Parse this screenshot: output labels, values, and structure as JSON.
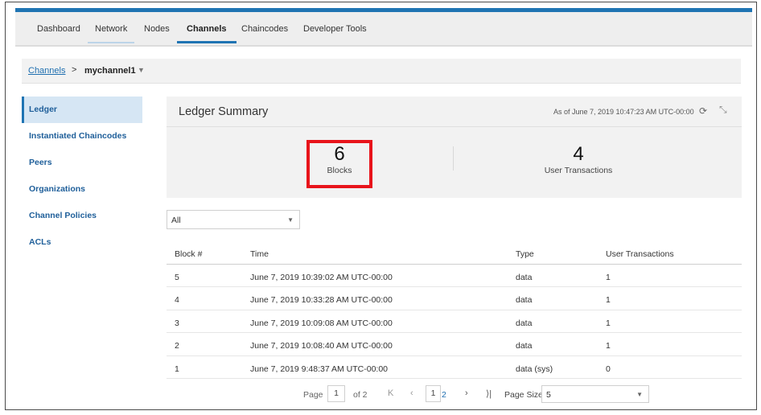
{
  "nav": {
    "tabs": [
      {
        "label": "Dashboard"
      },
      {
        "label": "Network"
      },
      {
        "label": "Nodes"
      },
      {
        "label": "Channels"
      },
      {
        "label": "Chaincodes"
      },
      {
        "label": "Developer Tools"
      }
    ],
    "active_tab": "Channels"
  },
  "breadcrumb": {
    "root": "Channels",
    "separator": ">",
    "current": "mychannel1",
    "caret": "▼"
  },
  "sidebar": {
    "items": [
      {
        "label": "Ledger"
      },
      {
        "label": "Instantiated Chaincodes"
      },
      {
        "label": "Peers"
      },
      {
        "label": "Organizations"
      },
      {
        "label": "Channel Policies"
      },
      {
        "label": "ACLs"
      }
    ],
    "active_item": "Ledger"
  },
  "summary": {
    "title": "Ledger Summary",
    "as_of": "As of June 7, 2019 10:47:23 AM UTC-00:00",
    "refresh_icon": "⟳",
    "collapse_icon": "⤡",
    "blocks": {
      "value": "6",
      "label": "Blocks"
    },
    "transactions": {
      "value": "4",
      "label": "User Transactions"
    },
    "highlight_color": "#e8141b"
  },
  "filter": {
    "value": "All",
    "arrow": "▼"
  },
  "table": {
    "headers": [
      "Block #",
      "Time",
      "Type",
      "User Transactions"
    ],
    "rows": [
      [
        "5",
        "June 7, 2019 10:39:02 AM UTC-00:00",
        "data",
        "1"
      ],
      [
        "4",
        "June 7, 2019 10:33:28 AM UTC-00:00",
        "data",
        "1"
      ],
      [
        "3",
        "June 7, 2019 10:09:08 AM UTC-00:00",
        "data",
        "1"
      ],
      [
        "2",
        "June 7, 2019 10:08:40 AM UTC-00:00",
        "data",
        "1"
      ],
      [
        "1",
        "June 7, 2019 9:48:37 AM UTC-00:00",
        "data (sys)",
        "0"
      ]
    ]
  },
  "pagination": {
    "page_label": "Page",
    "page_value": "1",
    "of_label": "of 2",
    "first_icon": "K",
    "prev_icon": "‹",
    "current_page": "1",
    "next_page": "2",
    "next_icon": "›",
    "last_icon": "⟩|",
    "page_size_label": "Page Size",
    "page_size_value": "5",
    "arrow": "▼"
  },
  "colors": {
    "accent": "#1f74b3",
    "link": "#1f6fb0",
    "panel": "#f2f2f2"
  }
}
